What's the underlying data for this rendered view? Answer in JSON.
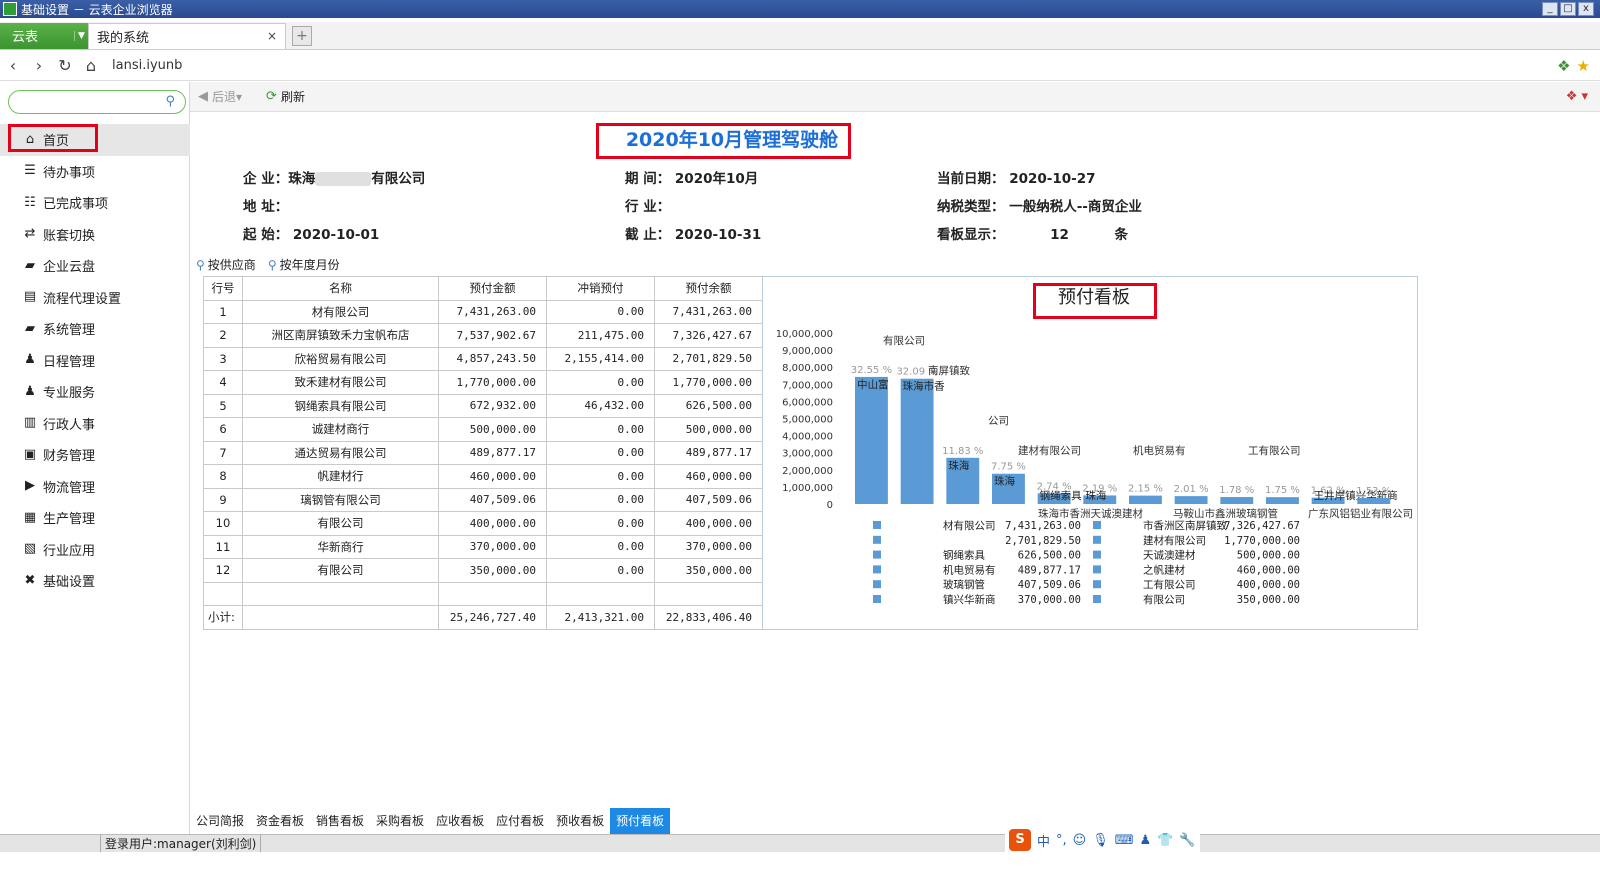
{
  "window": {
    "title": "基础设置 － 云表企业浏览器",
    "min": "_",
    "max": "□",
    "close": "x"
  },
  "tabs": {
    "brand": "云表",
    "page": "我的系统",
    "close": "×",
    "new": "+"
  },
  "address": {
    "url": "lansi.iyunb"
  },
  "sidebar": {
    "search_placeholder": "",
    "items": [
      {
        "label": "首页",
        "icon": "home-icon",
        "glyph": "⌂"
      },
      {
        "label": "待办事项",
        "icon": "list-icon",
        "glyph": "☰"
      },
      {
        "label": "已完成事项",
        "icon": "checklist-icon",
        "glyph": "☷"
      },
      {
        "label": "账套切换",
        "icon": "switch-icon",
        "glyph": "⇄"
      },
      {
        "label": "企业云盘",
        "icon": "folder-icon",
        "glyph": "▰"
      },
      {
        "label": "流程代理设置",
        "icon": "document-icon",
        "glyph": "▤"
      },
      {
        "label": "系统管理",
        "icon": "folder-icon",
        "glyph": "▰"
      },
      {
        "label": "日程管理",
        "icon": "person-calendar-icon",
        "glyph": "♟"
      },
      {
        "label": "专业服务",
        "icon": "person-icon",
        "glyph": "♟"
      },
      {
        "label": "行政人事",
        "icon": "chart-icon",
        "glyph": "▥"
      },
      {
        "label": "财务管理",
        "icon": "wallet-icon",
        "glyph": "▣"
      },
      {
        "label": "物流管理",
        "icon": "truck-icon",
        "glyph": "▶"
      },
      {
        "label": "生产管理",
        "icon": "factory-icon",
        "glyph": "▦"
      },
      {
        "label": "行业应用",
        "icon": "grid-icon",
        "glyph": "▧"
      },
      {
        "label": "基础设置",
        "icon": "tools-icon",
        "glyph": "✖"
      }
    ]
  },
  "toolbar": {
    "back": "后退",
    "refresh": "刷新"
  },
  "dashboard": {
    "title": "2020年10月管理驾驶舱",
    "company_label": "企 业：",
    "company_prefix": "珠海",
    "company_suffix": "有限公司",
    "address_label": "地 址：",
    "start_label": "起 始：",
    "start": "2020-10-01",
    "period_label": "期 间：",
    "period": "2020年10月",
    "industry_label": "行 业：",
    "end_label": "截 止：",
    "end": "2020-10-31",
    "today_label": "当前日期：",
    "today": "2020-10-27",
    "tax_label": "纳税类型：",
    "tax": "一般纳税人--商贸企业",
    "show_label": "看板显示：",
    "show_count": "12",
    "show_unit": "条"
  },
  "filters": {
    "by_supplier": "按供应商",
    "by_year_month": "按年度月份"
  },
  "table": {
    "headers": [
      "行号",
      "名称",
      "预付金额",
      "冲销预付",
      "预付余额"
    ],
    "rows": [
      [
        "1",
        "材有限公司",
        "7,431,263.00",
        "0.00",
        "7,431,263.00"
      ],
      [
        "2",
        "洲区南屏镇致禾力宝帆布店",
        "7,537,902.67",
        "211,475.00",
        "7,326,427.67"
      ],
      [
        "3",
        "欣裕贸易有限公司",
        "4,857,243.50",
        "2,155,414.00",
        "2,701,829.50"
      ],
      [
        "4",
        "致禾建材有限公司",
        "1,770,000.00",
        "0.00",
        "1,770,000.00"
      ],
      [
        "5",
        "钢绳索具有限公司",
        "672,932.00",
        "46,432.00",
        "626,500.00"
      ],
      [
        "6",
        "诚建材商行",
        "500,000.00",
        "0.00",
        "500,000.00"
      ],
      [
        "7",
        "通达贸易有限公司",
        "489,877.17",
        "0.00",
        "489,877.17"
      ],
      [
        "8",
        "帆建材行",
        "460,000.00",
        "0.00",
        "460,000.00"
      ],
      [
        "9",
        "璃钢管有限公司",
        "407,509.06",
        "0.00",
        "407,509.06"
      ],
      [
        "10",
        "有限公司",
        "400,000.00",
        "0.00",
        "400,000.00"
      ],
      [
        "11",
        "华新商行",
        "370,000.00",
        "0.00",
        "370,000.00"
      ],
      [
        "12",
        "有限公司",
        "350,000.00",
        "0.00",
        "350,000.00"
      ]
    ],
    "subtotal_label": "小计:",
    "subtotal": [
      "25,246,727.40",
      "2,413,321.00",
      "22,833,406.40"
    ]
  },
  "chart_data": {
    "type": "bar",
    "title": "预付看板",
    "ylim": [
      0,
      10000000
    ],
    "yticks": [
      "10,000,000",
      "9,000,000",
      "8,000,000",
      "7,000,000",
      "6,000,000",
      "5,000,000",
      "4,000,000",
      "3,000,000",
      "2,000,000",
      "1,000,000",
      "0"
    ],
    "values": [
      7431263,
      7326427.67,
      2701829.5,
      1770000,
      626500,
      500000,
      489877.17,
      460000,
      407509.06,
      400000,
      370000,
      350000
    ],
    "bar_labels": [
      "中山富",
      "珠海市香",
      "珠海",
      "珠海",
      "钢绳索具",
      "珠海",
      "",
      "",
      "",
      "",
      "王井岸镇兴华新商",
      ""
    ],
    "pct_labels": [
      "32.55 %",
      "32.09 %",
      "11.83 %",
      "7.75 %",
      "2.74 %",
      "2.19 %",
      "2.15 %",
      "2.01 %",
      "1.78 %",
      "1.75 %",
      "1.62 %",
      "1.53 %"
    ],
    "top_labels": [
      "有限公司",
      "南屏镇致",
      "公司",
      "建材有限公司",
      "机电贸易有",
      "工有限公司"
    ],
    "bottom_labels": [
      "珠海市香洲天诚澳建材",
      "马鞍山市鑫洲玻璃钢管",
      "广东风铝铝业有限公司"
    ],
    "legend_left": [
      [
        "材有限公司",
        "7,431,263.00"
      ],
      [
        "",
        "2,701,829.50"
      ],
      [
        "钢绳索具",
        "626,500.00"
      ],
      [
        "机电贸易有",
        "489,877.17"
      ],
      [
        "玻璃钢管",
        "407,509.06"
      ],
      [
        "镇兴华新商",
        "370,000.00"
      ]
    ],
    "legend_right": [
      [
        "市香洲区南屏镇致",
        "7,326,427.67"
      ],
      [
        "建材有限公司",
        "1,770,000.00"
      ],
      [
        "天诚澳建材",
        "500,000.00"
      ],
      [
        "之帆建材",
        "460,000.00"
      ],
      [
        "工有限公司",
        "400,000.00"
      ],
      [
        "有限公司",
        "350,000.00"
      ]
    ],
    "bar_color": "#5b9bd5"
  },
  "bottom_tabs": [
    "公司简报",
    "资金看板",
    "销售看板",
    "采购看板",
    "应收看板",
    "应付看板",
    "预收看板",
    "预付看板"
  ],
  "active_bottom_tab": 7,
  "status": {
    "user": "登录用户:manager(刘利剑)"
  },
  "ime": {
    "logo": "S",
    "lang": "中",
    "punct": "°,"
  }
}
